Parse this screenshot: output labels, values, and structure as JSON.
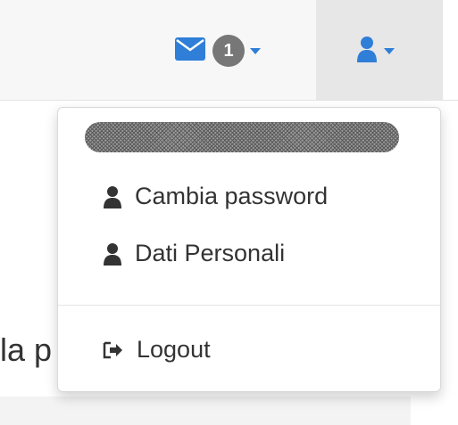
{
  "navbar": {
    "messages": {
      "icon": "envelope-icon",
      "badge_count": "1",
      "accent_color": "#2f7ed8",
      "badge_color": "#777777"
    },
    "user_menu": {
      "icon": "user-icon",
      "accent_color": "#2f7ed8"
    }
  },
  "dropdown": {
    "masked_username": "",
    "items": [
      {
        "label": "Cambia password",
        "icon": "user-icon"
      },
      {
        "label": "Dati Personali",
        "icon": "user-icon"
      }
    ],
    "logout": {
      "label": "Logout",
      "icon": "sign-out-icon"
    }
  },
  "page": {
    "snippet_text": "la p"
  }
}
